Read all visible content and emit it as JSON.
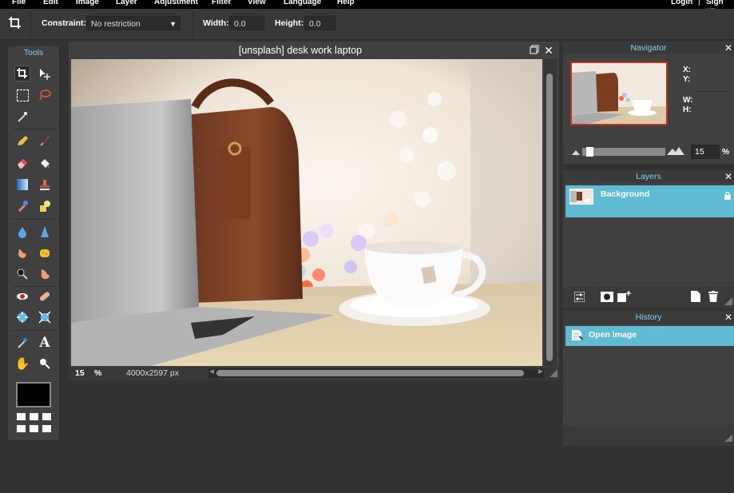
{
  "menubar": {
    "items": [
      "File",
      "Edit",
      "Image",
      "Layer",
      "Adjustment",
      "Filter",
      "View",
      "Language",
      "Help"
    ],
    "login": "Login",
    "separator": "|",
    "signup": "Sign up"
  },
  "options": {
    "constraint_label": "Constraint:",
    "constraint_value": "No restriction",
    "width_label": "Width:",
    "width_value": "0.0",
    "height_label": "Height:",
    "height_value": "0.0"
  },
  "tools": {
    "title": "Tools"
  },
  "document": {
    "title": "[unsplash] desk work laptop",
    "zoom": "15",
    "zoom_unit": "%",
    "dimensions": "4000x2597 px"
  },
  "navigator": {
    "title": "Navigator",
    "x_label": "X:",
    "y_label": "Y:",
    "w_label": "W:",
    "h_label": "H:",
    "zoom_value": "15",
    "zoom_unit": "%",
    "zoom_fraction": 0.05
  },
  "layers": {
    "title": "Layers",
    "items": [
      {
        "name": "Background"
      }
    ]
  },
  "history": {
    "title": "History",
    "items": [
      {
        "name": "Open image"
      }
    ]
  },
  "colors": {
    "accent": "#7fd0f0",
    "selection": "#5fbcd3",
    "foreground": "#000000"
  }
}
